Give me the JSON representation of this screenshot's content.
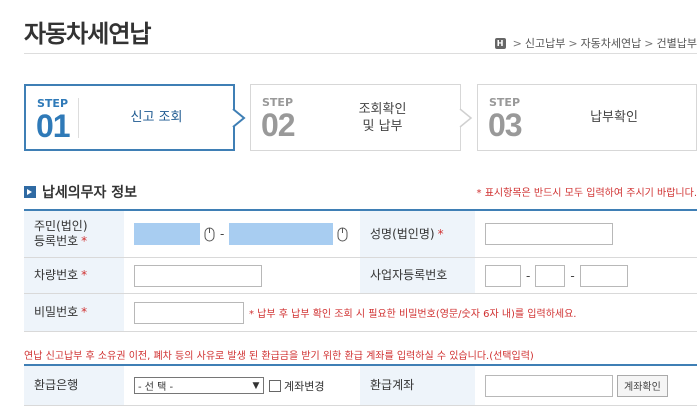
{
  "page": {
    "title": "자동차세연납"
  },
  "breadcrumb": {
    "home_icon_text": "H",
    "items": [
      "신고납부",
      "자동차세연납",
      "건별납부"
    ],
    "separator": ">"
  },
  "steps": [
    {
      "label": "STEP",
      "number": "01",
      "text": "신고 조회",
      "active": true
    },
    {
      "label": "STEP",
      "number": "02",
      "text_line1": "조회확인",
      "text_line2": "및 납부",
      "active": false
    },
    {
      "label": "STEP",
      "number": "03",
      "text": "납부확인",
      "active": false
    }
  ],
  "section": {
    "title": "납세의무자 정보",
    "required_note": "* 표시항목은 반드시 모두 입력하여 주시기 바랍니다."
  },
  "form": {
    "resident_no": {
      "label_line1": "주민(법인)",
      "label_line2": "등록번호",
      "required_mark": "*",
      "value1": "",
      "value2": ""
    },
    "name": {
      "label": "성명(법인명)",
      "required_mark": "*",
      "value": ""
    },
    "car_no": {
      "label": "차량번호",
      "required_mark": "*",
      "value": ""
    },
    "biz_no": {
      "label": "사업자등록번호",
      "value1": "",
      "value2": "",
      "value3": ""
    },
    "password": {
      "label": "비밀번호",
      "required_mark": "*",
      "value": "",
      "note": "* 납부 후 납부 확인 조회 시 필요한 비밀번호(영문/숫자 6자 내)를 입력하세요."
    }
  },
  "refund": {
    "note": "연납 신고납부 후 소유권 이전, 폐차 등의 사유로 발생 된 환급금을 받기 위한 환급 계좌를 입력하실 수 있습니다.(선택입력)",
    "bank_label": "환급은행",
    "bank_select_value": "- 선 택 -",
    "change_account_label": "계좌변경",
    "account_label": "환급계좌",
    "account_value": "",
    "confirm_button": "계좌확인"
  },
  "colors": {
    "accent": "#3f7fb5",
    "required": "#d03131",
    "header_bg": "#eef4fa",
    "masked_input": "#a8cdf1"
  }
}
